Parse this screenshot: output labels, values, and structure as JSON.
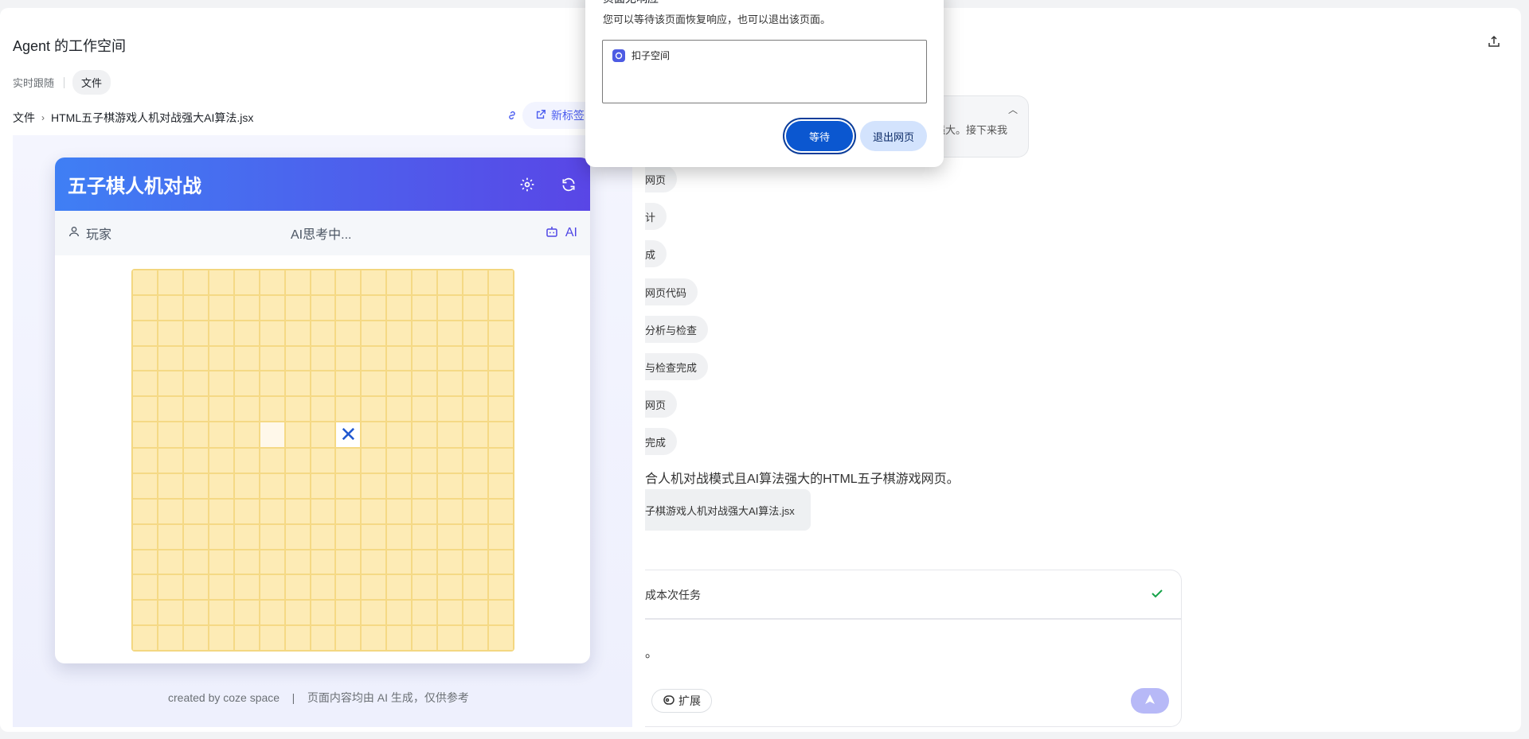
{
  "workspace": {
    "title": "Agent 的工作空间",
    "tab_follow": "实时跟随",
    "tab_files": "文件"
  },
  "breadcrumb": {
    "root": "文件",
    "separator": "›",
    "file": "HTML五子棋游戏人机对战强大AI算法.jsx"
  },
  "toolbar": {
    "new_tab_label": "新标签"
  },
  "game": {
    "title": "五子棋人机对战",
    "player_label": "玩家",
    "status_text": "AI思考中...",
    "ai_label": "AI",
    "board_size": 15,
    "last_move_mark": "✕",
    "colors": {
      "header_start": "#3f7ff4",
      "header_end": "#5946e6",
      "board": "#fdebb5",
      "mark": "#2058d0"
    }
  },
  "preview_footer": "created by coze space    |    页面内容均由 AI 生成，仅供参考",
  "chat": {
    "bubble_text": "强大。接下来我",
    "steps": [
      "网页",
      "计",
      "成",
      "网页代码",
      "分析与检查",
      "与检查完成",
      "网页",
      "完成"
    ],
    "summary": "合人机对战模式且AI算法强大的HTML五子棋游戏网页。",
    "file_chip": "子棋游戏人机对战强大AI算法.jsx",
    "task_status": "成本次任务",
    "input_value": "。",
    "expand_label": "扩展"
  },
  "dialog": {
    "title": "页面无响应",
    "description": "您可以等待该页面恢复响应，也可以退出该页面。",
    "page_item": "扣子空间",
    "wait_button": "等待",
    "exit_button": "退出网页"
  }
}
